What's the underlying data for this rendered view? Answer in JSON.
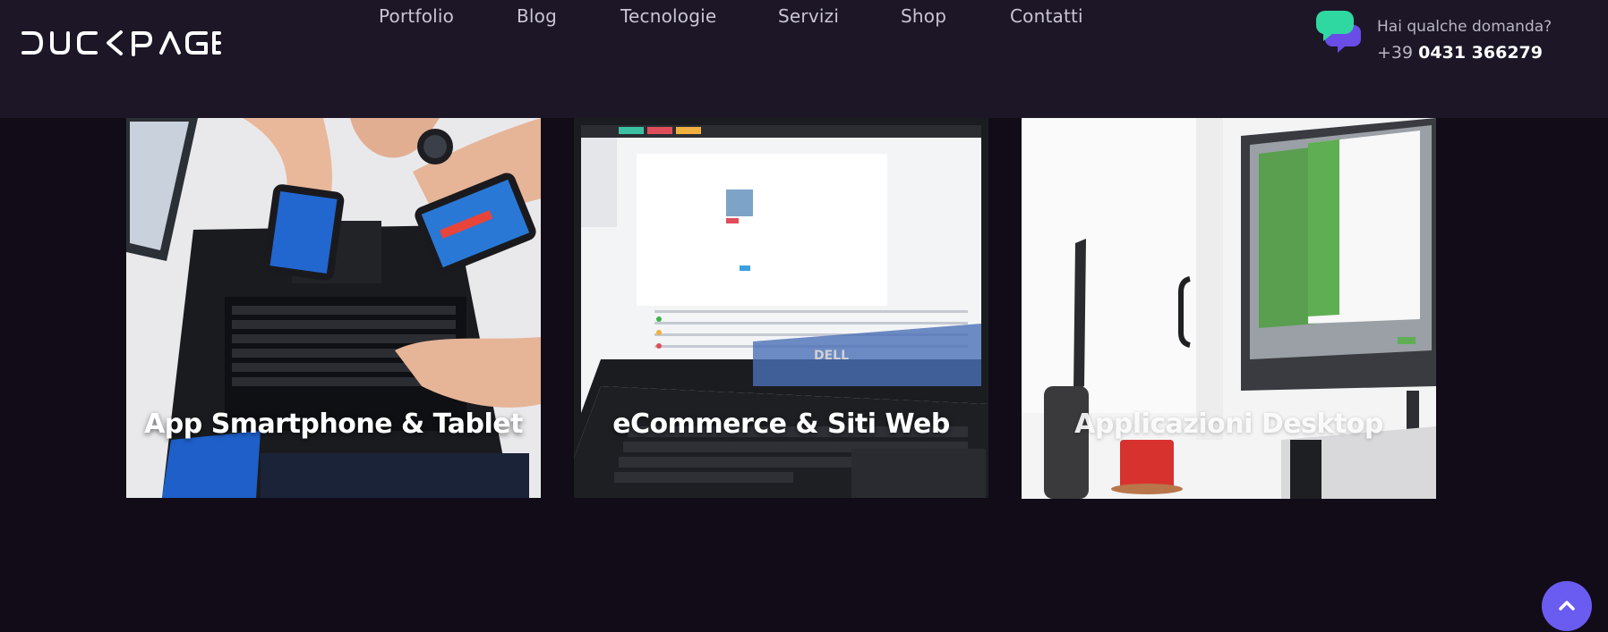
{
  "brand": {
    "logo_text": "DUCKPAGE"
  },
  "nav": {
    "items": [
      {
        "label": "Portfolio"
      },
      {
        "label": "Blog"
      },
      {
        "label": "Tecnologie"
      },
      {
        "label": "Servizi"
      },
      {
        "label": "Shop"
      },
      {
        "label": "Contatti"
      }
    ]
  },
  "contact": {
    "question": "Hai qualche domanda?",
    "phone_prefix": "+39",
    "phone_number": "0431 366279"
  },
  "cards": [
    {
      "title": "App Smartphone & Tablet",
      "image": "hands-phones-laptop"
    },
    {
      "title": "eCommerce & Siti Web",
      "image": "laptop-web-admin"
    },
    {
      "title": "Applicazioni Desktop",
      "image": "desktop-monitor-office"
    }
  ],
  "colors": {
    "page_bg": "#110c18",
    "header_bg": "#1c1626",
    "accent": "#6a5cf0",
    "chat_green": "#2fd8a0",
    "chat_purple": "#6a4ce6"
  },
  "icons": {
    "scroll_top": "chevron-up-icon",
    "chat": "chat-bubbles-icon"
  }
}
